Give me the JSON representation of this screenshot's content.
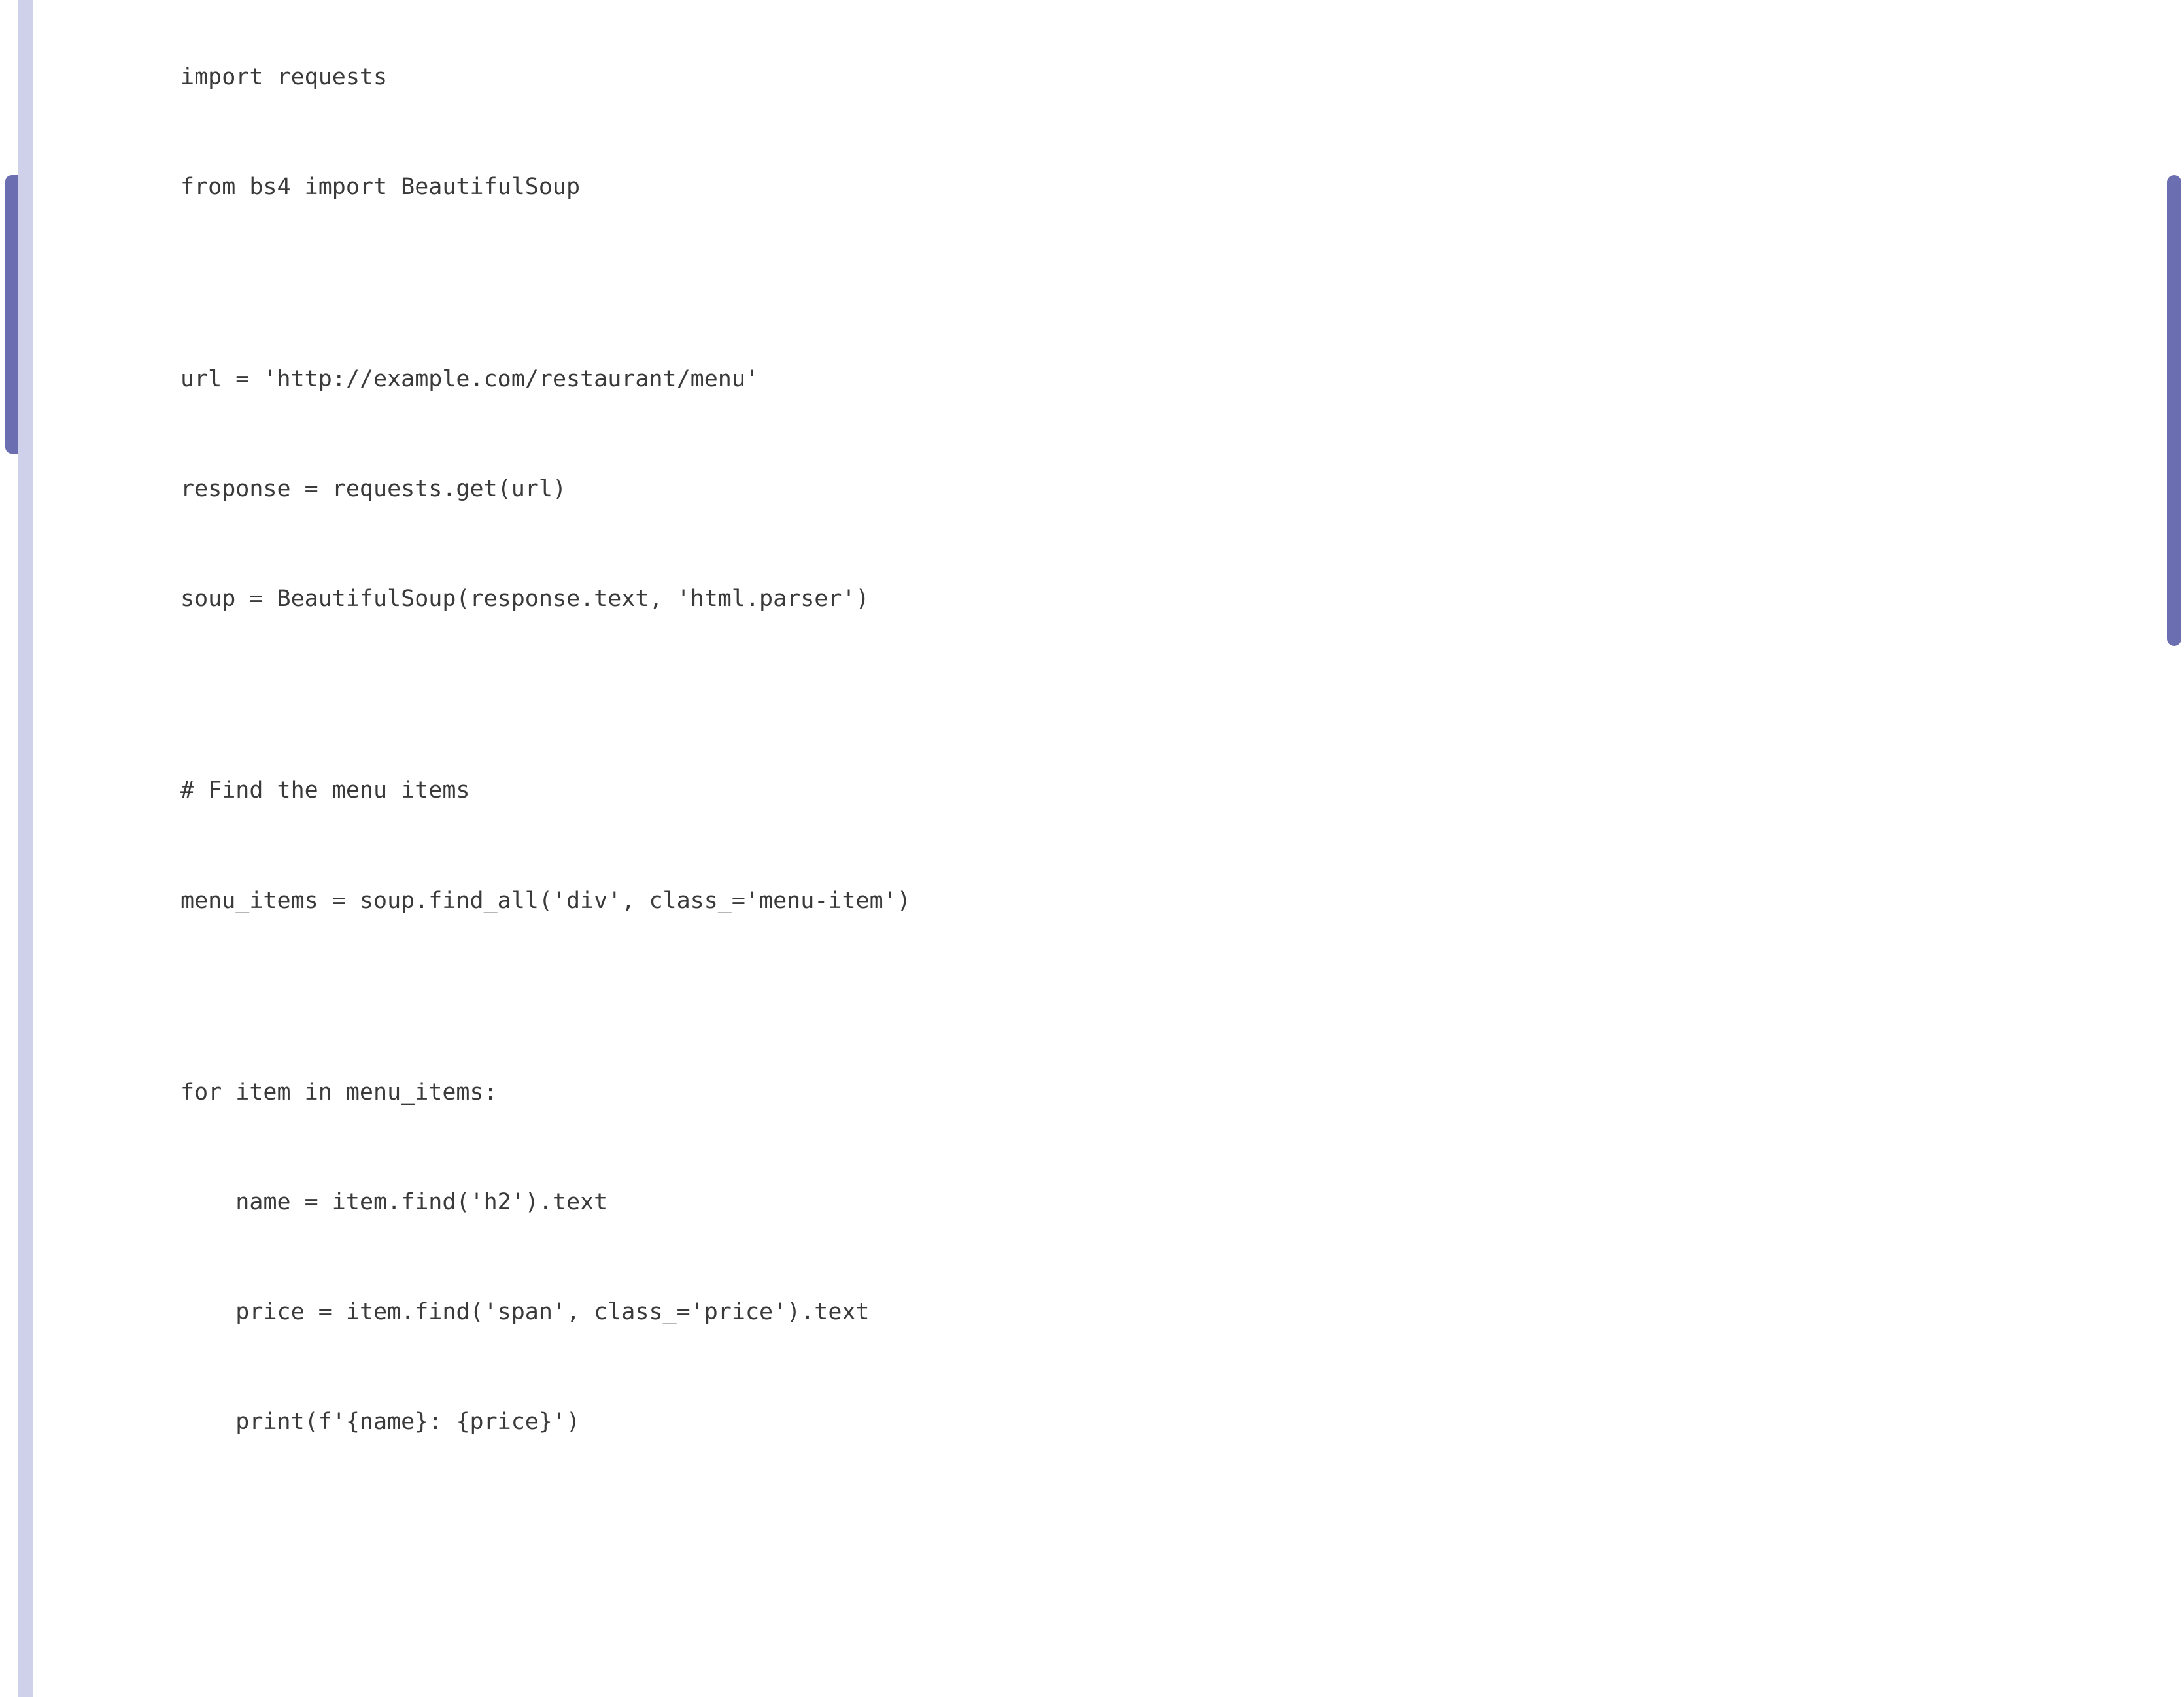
{
  "code": {
    "lines": [
      "import requests",
      "from bs4 import BeautifulSoup",
      "",
      "url = 'http://example.com/restaurant/menu'",
      "response = requests.get(url)",
      "soup = BeautifulSoup(response.text, 'html.parser')",
      "",
      "# Find the menu items",
      "menu_items = soup.find_all('div', class_='menu-item')",
      "",
      "for item in menu_items:",
      "    name = item.find('h2').text",
      "    price = item.find('span', class_='price').text",
      "    print(f'{name}: {price}')"
    ]
  }
}
